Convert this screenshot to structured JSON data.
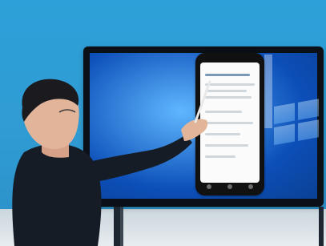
{
  "scene": {
    "background": "#2ea0d9",
    "tv_bezel": "#0b0f16",
    "screen_blue": "#0c4fb8",
    "person_jacket": "#161c25",
    "skin": "#e2b49a"
  },
  "icons": {
    "windows_logo": "windows-logo-icon",
    "phone": "phone-icon"
  }
}
